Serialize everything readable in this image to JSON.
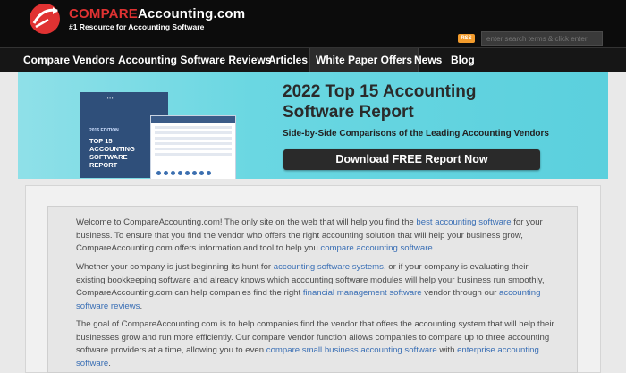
{
  "header": {
    "brand_prefix": "COMPARE",
    "brand_suffix": "Accounting.com",
    "tagline": "#1 Resource for Accounting Software",
    "rss_label": "RSS",
    "search_placeholder": "enter search terms & click enter"
  },
  "nav": {
    "items": [
      {
        "label": "Compare Vendors"
      },
      {
        "label": "Accounting Software Reviews"
      },
      {
        "label": "Articles"
      },
      {
        "label": "White Paper Offers"
      },
      {
        "label": "News"
      },
      {
        "label": "Blog"
      }
    ]
  },
  "banner": {
    "title": "2022 Top 15 Accounting Software Report",
    "subtitle": "Side-by-Side Comparisons of the Leading Accounting Vendors",
    "cta": "Download FREE Report Now",
    "book_edition": "2016 EDITION",
    "book_title": "TOP 15 ACCOUNTING SOFTWARE REPORT"
  },
  "content": {
    "p1": [
      "Welcome to CompareAccounting.com! The only site on the web that will help you find the ",
      "best accounting software",
      " for your business. To ensure that you find the vendor who offers the right accounting solution that will help your business grow, CompareAccounting.com offers information and tool to help you ",
      "compare accounting software",
      "."
    ],
    "p2": [
      "Whether your company is just beginning its hunt for ",
      "accounting software systems",
      ", or if your company is evaluating their existing bookkeeping software and already knows which accounting software modules will help your business run smoothly, CompareAccounting.com can help companies find the right ",
      "financial management software",
      " vendor through our ",
      "accounting software reviews",
      "."
    ],
    "p3": [
      "The goal of CompareAccounting.com is to help companies find the vendor that offers the accounting system that will help their businesses grow and run more efficiently. Our compare vendor function allows companies to compare up to three accounting software providers at a time, allowing you to even ",
      "compare small business accounting software",
      " with ",
      "enterprise accounting software",
      "."
    ]
  },
  "colors": {
    "accent_red": "#e03232",
    "banner_bg": "#5bd0dd",
    "link": "#3a6fb5",
    "header_bg": "#0c0c0c"
  }
}
